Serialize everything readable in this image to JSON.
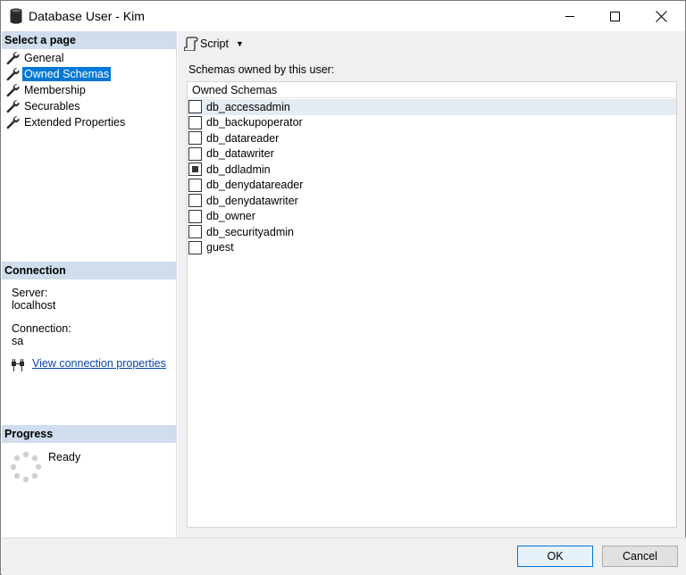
{
  "window": {
    "title": "Database User - Kim"
  },
  "select_page": {
    "header": "Select a page",
    "items": [
      {
        "label": "General",
        "selected": false
      },
      {
        "label": "Owned Schemas",
        "selected": true
      },
      {
        "label": "Membership",
        "selected": false
      },
      {
        "label": "Securables",
        "selected": false
      },
      {
        "label": "Extended Properties",
        "selected": false
      }
    ]
  },
  "connection": {
    "header": "Connection",
    "server_label": "Server:",
    "server_value": "localhost",
    "connection_label": "Connection:",
    "connection_value": "sa",
    "link_text": "View connection properties"
  },
  "progress": {
    "header": "Progress",
    "status": "Ready"
  },
  "toolbar": {
    "script_label": "Script"
  },
  "main": {
    "section_label": "Schemas owned by this user:",
    "column_header": "Owned Schemas",
    "schemas": [
      {
        "name": "db_accessadmin",
        "checked": false
      },
      {
        "name": "db_backupoperator",
        "checked": false
      },
      {
        "name": "db_datareader",
        "checked": false
      },
      {
        "name": "db_datawriter",
        "checked": false
      },
      {
        "name": "db_ddladmin",
        "checked": true
      },
      {
        "name": "db_denydatareader",
        "checked": false
      },
      {
        "name": "db_denydatawriter",
        "checked": false
      },
      {
        "name": "db_owner",
        "checked": false
      },
      {
        "name": "db_securityadmin",
        "checked": false
      },
      {
        "name": "guest",
        "checked": false
      }
    ]
  },
  "buttons": {
    "ok": "OK",
    "cancel": "Cancel"
  },
  "colors": {
    "selection": "#0078d7",
    "section_header_bg": "#cfdded",
    "row_highlight": "#e4ebf2",
    "link": "#0645ad"
  }
}
